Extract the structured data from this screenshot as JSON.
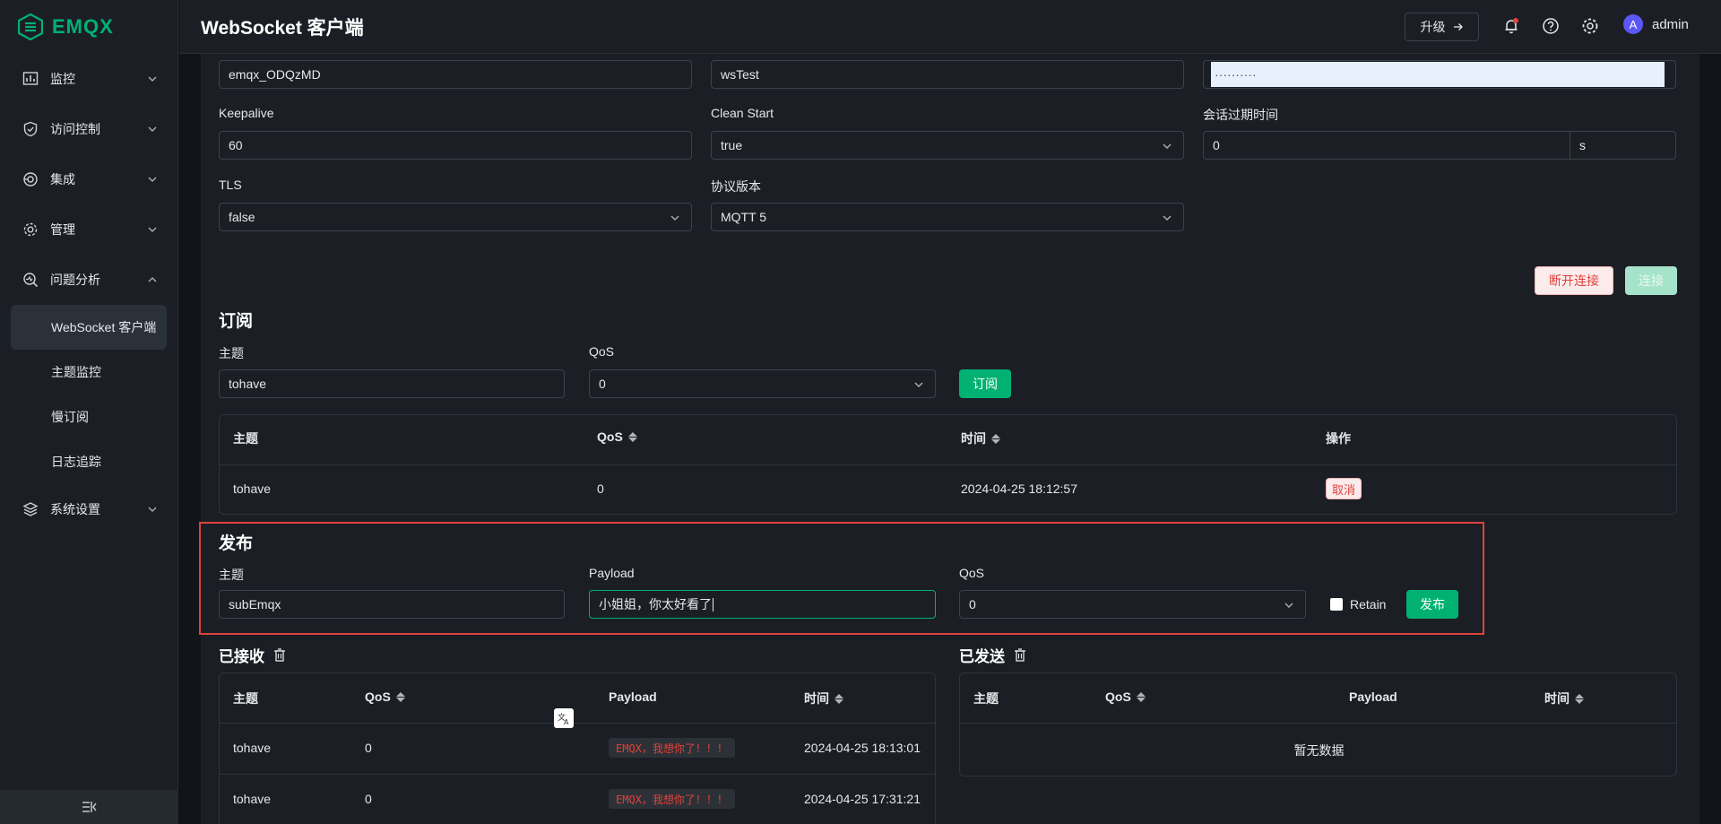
{
  "app": {
    "logo_text": "EMQX",
    "brand_color": "#00b173"
  },
  "sidebar": {
    "items": [
      {
        "label": "监控",
        "icon": "chart-icon"
      },
      {
        "label": "访问控制",
        "icon": "shield-icon"
      },
      {
        "label": "集成",
        "icon": "integration-icon"
      },
      {
        "label": "管理",
        "icon": "gear-icon"
      },
      {
        "label": "问题分析",
        "icon": "diagnose-icon"
      },
      {
        "label": "系统设置",
        "icon": "layers-icon"
      }
    ],
    "sub_items": [
      "WebSocket 客户端",
      "主题监控",
      "慢订阅",
      "日志追踪"
    ]
  },
  "header": {
    "title": "WebSocket 客户端",
    "upgrade_label": "升级",
    "user": "admin",
    "avatar_letter": "A"
  },
  "connection": {
    "client_id": "emqx_ODQzMD",
    "username": "wsTest",
    "password": "··········",
    "keepalive_label": "Keepalive",
    "keepalive": "60",
    "clean_start_label": "Clean Start",
    "clean_start": "true",
    "session_expiry_label": "会话过期时间",
    "session_expiry": "0",
    "session_expiry_unit": "s",
    "tls_label": "TLS",
    "tls": "false",
    "protocol_label": "协议版本",
    "protocol": "MQTT 5",
    "disconnect_label": "断开连接",
    "connect_label": "连接"
  },
  "subscribe": {
    "title": "订阅",
    "topic_label": "主题",
    "topic": "tohave",
    "qos_label": "QoS",
    "qos": "0",
    "button": "订阅",
    "columns": [
      "主题",
      "QoS",
      "时间",
      "操作"
    ],
    "rows": [
      {
        "topic": "tohave",
        "qos": "0",
        "time": "2024-04-25 18:12:57",
        "action": "取消"
      }
    ]
  },
  "publish": {
    "title": "发布",
    "topic_label": "主题",
    "topic": "subEmqx",
    "payload_label": "Payload",
    "payload": "小姐姐，你太好看了",
    "qos_label": "QoS",
    "qos": "0",
    "retain_label": "Retain",
    "button": "发布"
  },
  "received": {
    "title": "已接收",
    "columns": [
      "主题",
      "QoS",
      "Payload",
      "时间"
    ],
    "rows": [
      {
        "topic": "tohave",
        "qos": "0",
        "payload": "EMQX，我想你了！！！",
        "time": "2024-04-25 18:13:01"
      },
      {
        "topic": "tohave",
        "qos": "0",
        "payload": "EMQX，我想你了！！！",
        "time": "2024-04-25 17:31:21"
      }
    ]
  },
  "sent": {
    "title": "已发送",
    "columns": [
      "主题",
      "QoS",
      "Payload",
      "时间"
    ],
    "empty_text": "暂无数据"
  }
}
